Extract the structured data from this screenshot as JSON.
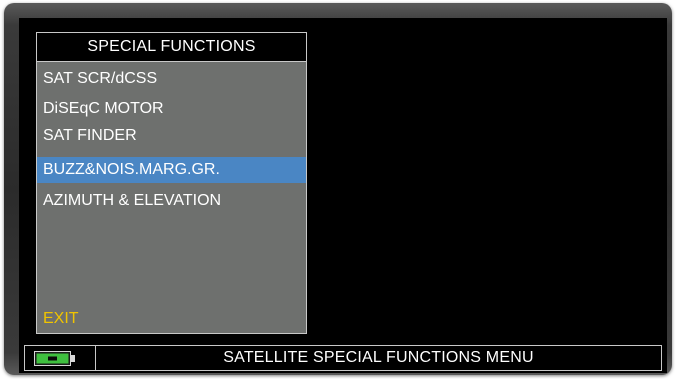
{
  "menu": {
    "title": "SPECIAL FUNCTIONS",
    "items": [
      {
        "label": "SAT SCR/dCSS",
        "selected": false
      },
      {
        "label": "DiSEqC MOTOR",
        "selected": false
      },
      {
        "label": "SAT FINDER",
        "selected": false
      },
      {
        "label": "BUZZ&NOIS.MARG.GR.",
        "selected": true
      },
      {
        "label": "AZIMUTH & ELEVATION",
        "selected": false
      }
    ],
    "exit_label": "EXIT"
  },
  "status_bar": {
    "battery_icon": "battery-icon",
    "text": "SATELLITE SPECIAL FUNCTIONS MENU"
  },
  "colors": {
    "screen_background": "#000000",
    "menu_background": "#6e706e",
    "selection_highlight": "#4a86c4",
    "exit_text": "#f0c400",
    "battery_fill": "#3fbf3f"
  }
}
